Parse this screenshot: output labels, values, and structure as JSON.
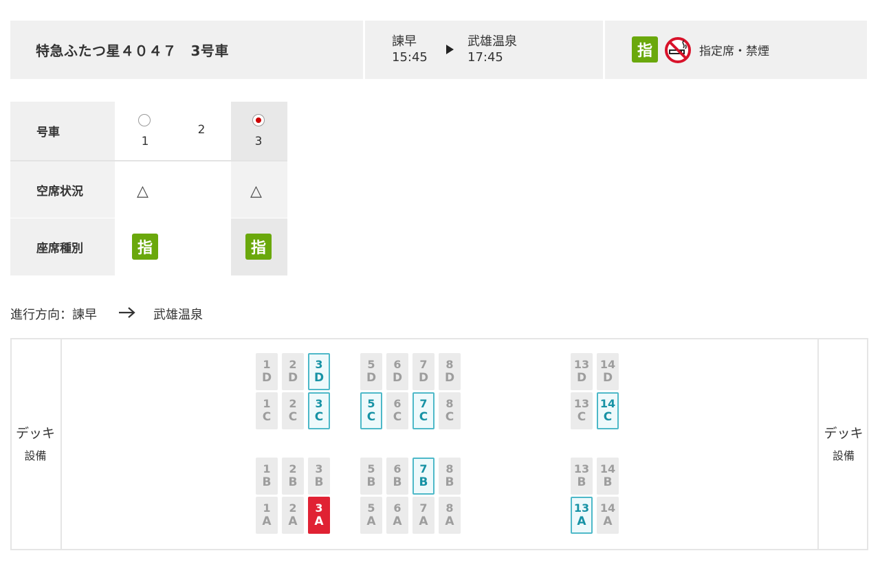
{
  "header": {
    "train_name": "特急ふたつ星４０４７　3号車",
    "from_station": "諫早",
    "from_time": "15:45",
    "to_station": "武雄温泉",
    "to_time": "17:45",
    "seat_badge": "指",
    "type_label": "指定席・禁煙",
    "icons": [
      "arrow-right-icon",
      "no-smoking-icon"
    ]
  },
  "car_table": {
    "row_labels": [
      "号車",
      "空席状況",
      "座席種別"
    ],
    "cars": [
      {
        "number": "1",
        "selected": false,
        "availability": "△",
        "badge": "指"
      },
      {
        "number": "2",
        "selected": false,
        "availability": "",
        "badge": ""
      },
      {
        "number": "3",
        "selected": true,
        "availability": "△",
        "badge": "指"
      }
    ]
  },
  "direction": {
    "prefix": "進行方向：諫早",
    "to": "武雄温泉"
  },
  "seatmap": {
    "deck_left": {
      "line1": "デッキ",
      "line2": "設備"
    },
    "deck_right": {
      "line1": "デッキ",
      "line2": "設備"
    },
    "rows": [
      1,
      2,
      3,
      5,
      6,
      7,
      8,
      13,
      14
    ],
    "letters": [
      "D",
      "C",
      "B",
      "A"
    ],
    "available": [
      "3D",
      "3C",
      "5C",
      "7C",
      "14C",
      "7B",
      "13A"
    ],
    "selected": [
      "3A"
    ],
    "colors": {
      "available_border": "#4cb8c8",
      "available_text": "#1792a5",
      "selected": "#e02233",
      "occupied": "#ebebeb",
      "shitei": "#6aa80c"
    }
  }
}
